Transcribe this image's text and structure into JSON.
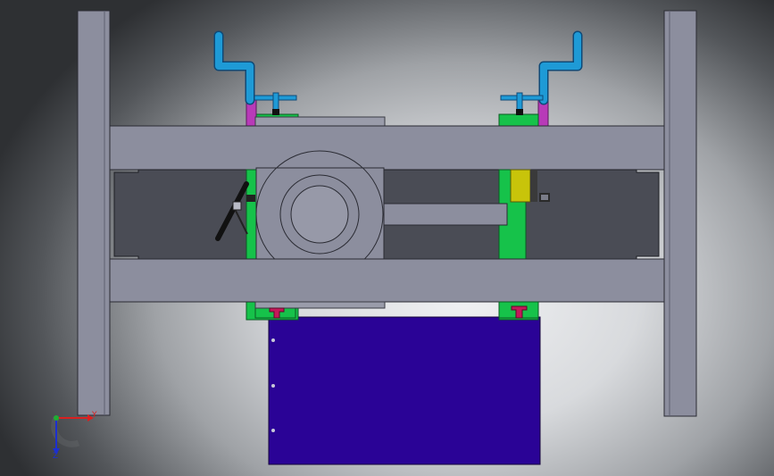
{
  "view": {
    "colors": {
      "frame_steel": "#8c8e9e",
      "frame_dark": "#7a7c8c",
      "cavity": "#4a4c55",
      "guide_green": "#16c24a",
      "riser_magenta": "#b83ab8",
      "pipe_blue": "#1e9ad6",
      "clamp_yellow": "#c8c40a",
      "stopper_red": "#c4185a",
      "cover_plate": "#2a0396"
    },
    "triad": {
      "y_label": "Y",
      "z_label": "Z",
      "y_color": "#d92020",
      "z_color": "#1c2fd0",
      "x_color": "#1fae33"
    }
  }
}
